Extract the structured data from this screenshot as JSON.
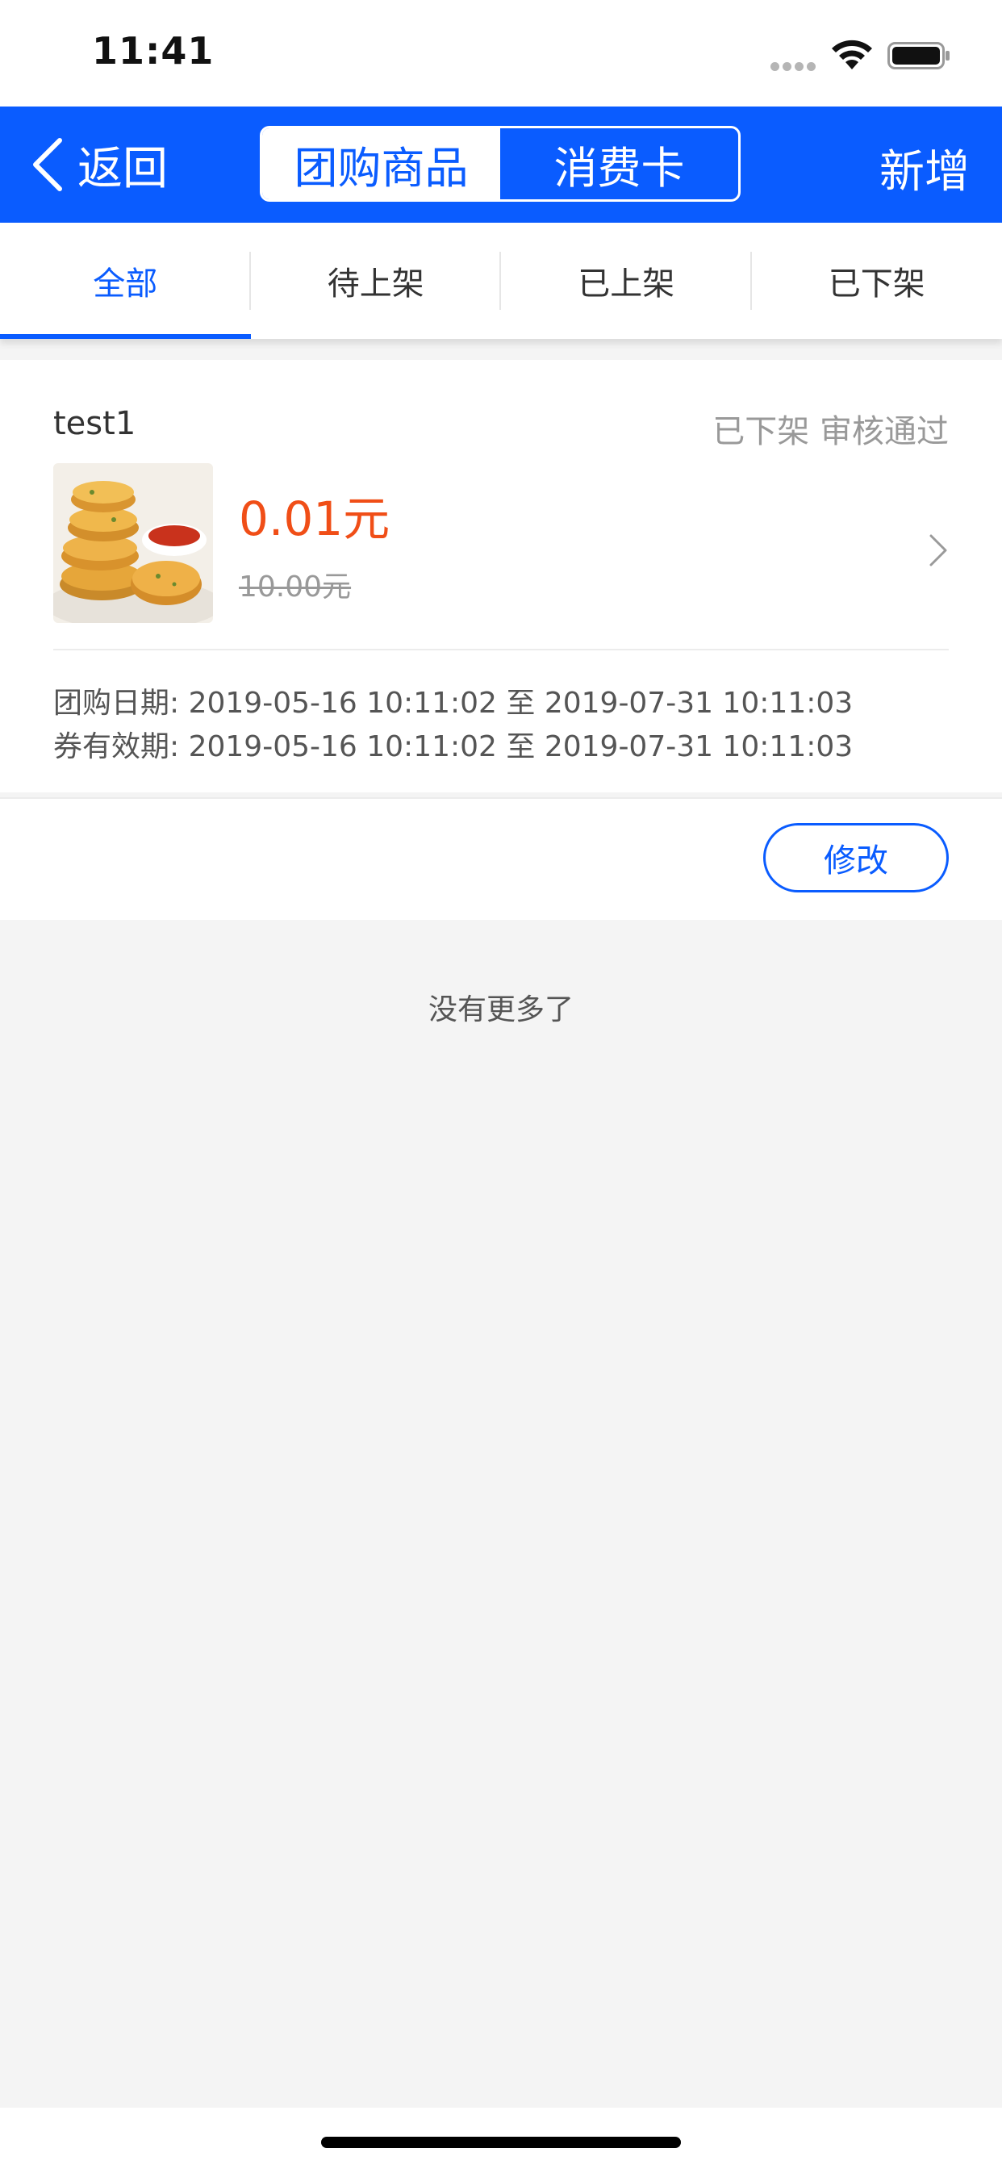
{
  "status_bar": {
    "time": "11:41"
  },
  "nav": {
    "back_label": "返回",
    "segments": [
      {
        "label": "团购商品",
        "active": true
      },
      {
        "label": "消费卡",
        "active": false
      }
    ],
    "add_label": "新增"
  },
  "filter_tabs": [
    {
      "label": "全部",
      "active": true
    },
    {
      "label": "待上架",
      "active": false
    },
    {
      "label": "已上架",
      "active": false
    },
    {
      "label": "已下架",
      "active": false
    }
  ],
  "item": {
    "title": "test1",
    "status": "已下架 审核通过",
    "price": "0.01元",
    "original_price": "10.00元",
    "group_date_label": "团购日期:",
    "group_date_range": "2019-05-16 10:11:02 至 2019-07-31 10:11:03",
    "coupon_date_label": "券有效期:",
    "coupon_date_range": "2019-05-16 10:11:02 至 2019-07-31 10:11:03",
    "edit_label": "修改"
  },
  "footer_text": "没有更多了",
  "colors": {
    "brand_blue": "#0a5cff",
    "price_orange": "#f04e17",
    "background": "#f4f4f4"
  }
}
